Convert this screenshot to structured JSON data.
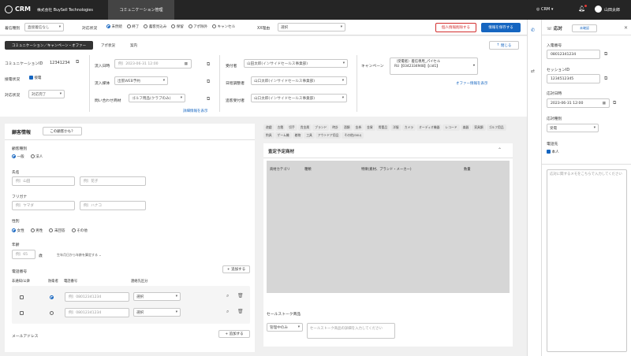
{
  "top": {
    "logo": "CRM",
    "company": "株式会社 BuySell Technologies",
    "tab": "コミュニケーション管理",
    "crm_menu": "CRM",
    "user": "山田太郎"
  },
  "filter": {
    "caller_type_label": "着信種別",
    "caller_type_value": "直接着信なし",
    "status_label": "対応状況",
    "status_options": [
      "未然続",
      "終了",
      "蓄客見込み",
      "保留",
      "アポ除外",
      "キャンセル"
    ],
    "xx_label": "XX理由",
    "xx_value": "選択",
    "delete_btn": "個人情報削除する",
    "save_btn": "情報を保存する"
  },
  "subtabs": {
    "items": [
      "コミュニケーション／キャンペーン・オファー",
      "アポ状況",
      "案内"
    ],
    "close_btn": "閉じる"
  },
  "comm": {
    "id_label": "コミュニケーションID",
    "id_value": "12341234",
    "inbound_label": "接電状況",
    "inbound_value": "接電",
    "handle_label": "対応状況",
    "handle_value": "対応完了",
    "recv_date_label": "流入日時",
    "recv_date_value": "例）2023-06-31 12:00",
    "recv_media_label": "流入媒体",
    "recv_media_value": "出張WEB予約",
    "inquiry_label": "問い合わせ商材",
    "inquiry_value": "ゴルフ用品(クラブのみ)",
    "details_link": "詳細情報を表示",
    "receiver_label": "受付者",
    "receiver_value": "山田太郎(インサイドセールス事業部)",
    "schedule_label": "日程調整者",
    "schedule_value": "山口太郎(インサイドセールス事業部)",
    "follow_label": "追客受付者",
    "follow_value": "山口太郎(インサイドセールス事業部)",
    "campaign_label": "キャンペーン",
    "campaign_line1": "（受電者）着信専用_パイセル",
    "campaign_line2": "RU【0342334948】【cid1】",
    "offer_link": "オファー情報を表示"
  },
  "customer": {
    "title": "顧客情報",
    "help_btn": "この顧客かも？",
    "type_label": "顧客種別",
    "type_opts": [
      "一般",
      "法人"
    ],
    "name_label": "氏名",
    "last_ph": "例）山田",
    "first_ph": "例）花子",
    "kana_label": "フリガナ",
    "kana_last_ph": "例）ヤマダ",
    "kana_first_ph": "例）ハナコ",
    "gender_label": "性別",
    "gender_opts": [
      "女性",
      "男性",
      "未回答",
      "その他"
    ],
    "age_label": "年齢",
    "age_ph": "例）65",
    "age_unit": "歳",
    "age_hint": "生年月日から年齢を算定する",
    "phone_label": "電話番号",
    "add_btn": "追加する",
    "phone_cols": [
      "非通知/公衆",
      "防衛者",
      "電話番号",
      "連絡先区分"
    ],
    "phone_ph": "例）08012341234",
    "select_ph": "選択",
    "mail_label": "メールアドレス"
  },
  "products": {
    "chips": [
      "遊戯",
      "古銭",
      "切手",
      "貴金属",
      "ブランド",
      "時計",
      "酒類",
      "金券",
      "金貨",
      "骨董品",
      "洋服",
      "カメラ",
      "オーディオ機器",
      "レコード",
      "楽器",
      "家具類",
      "ゴルフ用品",
      "釣具",
      "ゲーム機",
      "着物",
      "工具",
      "アウトドア用品",
      "その他(SKU)"
    ],
    "title": "査定予定商材",
    "cols": [
      "商材カテゴリ",
      "種類",
      "特徴(素材、ブランド・メーカー)",
      "数量"
    ],
    "sales_label": "セールストーク商品",
    "sales_select": "管理中のみ",
    "sales_ph": "セールストーク商品の詳細を入力してください"
  },
  "right": {
    "tab_label": "応対",
    "tab_btn": "未確認",
    "in_phone_label": "入電番号",
    "in_phone": "08012341234",
    "session_label": "セッションID",
    "session": "1234512345",
    "date_label": "応対日時",
    "date_value": "2023-06-31 12:00",
    "kind_label": "応対種別",
    "kind_value": "受電",
    "caller_label": "電話先",
    "caller_value": "本人",
    "memo_ph": "応対に関するメモをこちらで入力してください"
  },
  "colors": {
    "accent": "#1565c0",
    "topbar": "#252525",
    "danger": "#d32f2f"
  }
}
